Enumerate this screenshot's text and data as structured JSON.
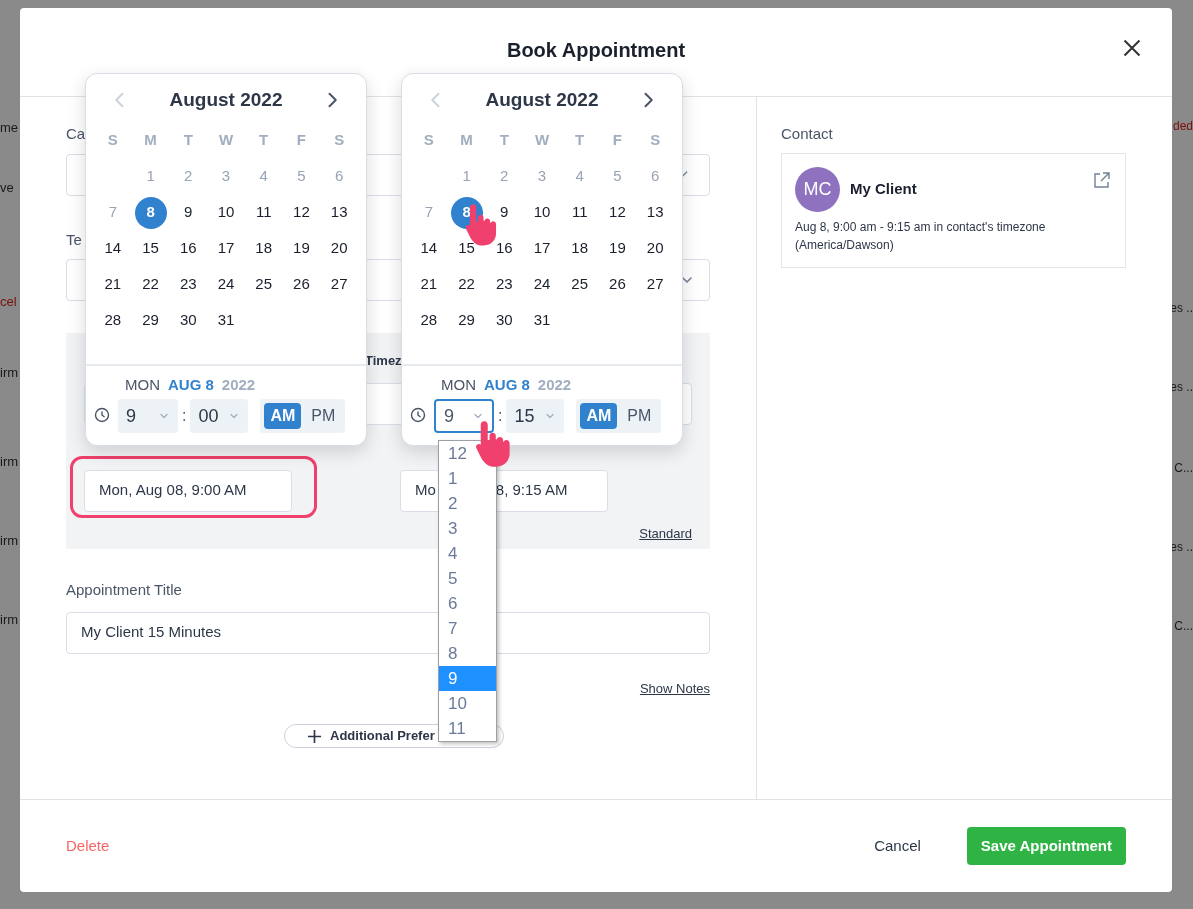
{
  "backdrop": {
    "left_fragments": [
      {
        "text": "me",
        "color": "#1a1a1a"
      },
      {
        "text": "ve",
        "color": "#1a1a1a"
      },
      {
        "text": "cel",
        "color": "#7a1010"
      },
      {
        "text": "irm",
        "color": "#1a1a1a"
      },
      {
        "text": "irm",
        "color": "#1a1a1a"
      },
      {
        "text": "irm",
        "color": "#1a1a1a"
      },
      {
        "text": "irm",
        "color": "#1a1a1a"
      }
    ],
    "right_fragments": [
      {
        "text": "ded",
        "color": "#7a1010"
      },
      {
        "text": "es ..",
        "color": "#1a1a1a"
      },
      {
        "text": "es ..",
        "color": "#1a1a1a"
      },
      {
        "text": "C...",
        "color": "#1a1a1a"
      },
      {
        "text": "es ..",
        "color": "#1a1a1a"
      },
      {
        "text": "C...",
        "color": "#1a1a1a"
      }
    ]
  },
  "modal": {
    "title": "Book Appointment"
  },
  "form": {
    "calendar_label": "Ca",
    "team_label": "Te",
    "timezone_label": "Timez",
    "start_field": {
      "value_parts": [
        "Mon, Aug 08, 9:00 AM"
      ],
      "highlighted": true
    },
    "end_field": {
      "value_parts": [
        "Mo",
        "8, 9:15 AM"
      ]
    },
    "standard_link": "Standard",
    "title_label": "Appointment Title",
    "title_value": "My Client 15 Minutes",
    "show_notes_link": "Show Notes",
    "additional_button": "Additional Prefer"
  },
  "pickers": [
    {
      "month": "August 2022",
      "weekdays": [
        "S",
        "M",
        "T",
        "W",
        "T",
        "F",
        "S"
      ],
      "days": [
        {
          "kind": "blank"
        },
        {
          "kind": "day",
          "label": "1",
          "disabled": true,
          "selected": false
        },
        {
          "kind": "day",
          "label": "2",
          "disabled": true,
          "selected": false
        },
        {
          "kind": "day",
          "label": "3",
          "disabled": true,
          "selected": false
        },
        {
          "kind": "day",
          "label": "4",
          "disabled": true,
          "selected": false
        },
        {
          "kind": "day",
          "label": "5",
          "disabled": true,
          "selected": false
        },
        {
          "kind": "day",
          "label": "6",
          "disabled": true,
          "selected": false
        },
        {
          "kind": "day",
          "label": "7",
          "disabled": true,
          "selected": false
        },
        {
          "kind": "day",
          "label": "8",
          "disabled": false,
          "selected": true
        },
        {
          "kind": "day",
          "label": "9",
          "disabled": false,
          "selected": false
        },
        {
          "kind": "day",
          "label": "10",
          "disabled": false,
          "selected": false
        },
        {
          "kind": "day",
          "label": "11",
          "disabled": false,
          "selected": false
        },
        {
          "kind": "day",
          "label": "12",
          "disabled": false,
          "selected": false
        },
        {
          "kind": "day",
          "label": "13",
          "disabled": false,
          "selected": false
        },
        {
          "kind": "day",
          "label": "14",
          "disabled": false,
          "selected": false
        },
        {
          "kind": "day",
          "label": "15",
          "disabled": false,
          "selected": false
        },
        {
          "kind": "day",
          "label": "16",
          "disabled": false,
          "selected": false
        },
        {
          "kind": "day",
          "label": "17",
          "disabled": false,
          "selected": false
        },
        {
          "kind": "day",
          "label": "18",
          "disabled": false,
          "selected": false
        },
        {
          "kind": "day",
          "label": "19",
          "disabled": false,
          "selected": false
        },
        {
          "kind": "day",
          "label": "20",
          "disabled": false,
          "selected": false
        },
        {
          "kind": "day",
          "label": "21",
          "disabled": false,
          "selected": false
        },
        {
          "kind": "day",
          "label": "22",
          "disabled": false,
          "selected": false
        },
        {
          "kind": "day",
          "label": "23",
          "disabled": false,
          "selected": false
        },
        {
          "kind": "day",
          "label": "24",
          "disabled": false,
          "selected": false
        },
        {
          "kind": "day",
          "label": "25",
          "disabled": false,
          "selected": false
        },
        {
          "kind": "day",
          "label": "26",
          "disabled": false,
          "selected": false
        },
        {
          "kind": "day",
          "label": "27",
          "disabled": false,
          "selected": false
        },
        {
          "kind": "day",
          "label": "28",
          "disabled": false,
          "selected": false
        },
        {
          "kind": "day",
          "label": "29",
          "disabled": false,
          "selected": false
        },
        {
          "kind": "day",
          "label": "30",
          "disabled": false,
          "selected": false
        },
        {
          "kind": "day",
          "label": "31",
          "disabled": false,
          "selected": false
        }
      ],
      "weekday_name": "MON",
      "date": "AUG 8",
      "year": "2022",
      "hour": "9",
      "separator": ":",
      "minute": "00",
      "hour_focused": false,
      "meridiem": [
        {
          "label": "AM",
          "selected": true
        },
        {
          "label": "PM",
          "selected": false
        }
      ]
    },
    {
      "month": "August 2022",
      "weekdays": [
        "S",
        "M",
        "T",
        "W",
        "T",
        "F",
        "S"
      ],
      "days": [
        {
          "kind": "blank"
        },
        {
          "kind": "day",
          "label": "1",
          "disabled": true,
          "selected": false
        },
        {
          "kind": "day",
          "label": "2",
          "disabled": true,
          "selected": false
        },
        {
          "kind": "day",
          "label": "3",
          "disabled": true,
          "selected": false
        },
        {
          "kind": "day",
          "label": "4",
          "disabled": true,
          "selected": false
        },
        {
          "kind": "day",
          "label": "5",
          "disabled": true,
          "selected": false
        },
        {
          "kind": "day",
          "label": "6",
          "disabled": true,
          "selected": false
        },
        {
          "kind": "day",
          "label": "7",
          "disabled": true,
          "selected": false
        },
        {
          "kind": "day",
          "label": "8",
          "disabled": false,
          "selected": true
        },
        {
          "kind": "day",
          "label": "9",
          "disabled": false,
          "selected": false
        },
        {
          "kind": "day",
          "label": "10",
          "disabled": false,
          "selected": false
        },
        {
          "kind": "day",
          "label": "11",
          "disabled": false,
          "selected": false
        },
        {
          "kind": "day",
          "label": "12",
          "disabled": false,
          "selected": false
        },
        {
          "kind": "day",
          "label": "13",
          "disabled": false,
          "selected": false
        },
        {
          "kind": "day",
          "label": "14",
          "disabled": false,
          "selected": false
        },
        {
          "kind": "day",
          "label": "15",
          "disabled": false,
          "selected": false
        },
        {
          "kind": "day",
          "label": "16",
          "disabled": false,
          "selected": false
        },
        {
          "kind": "day",
          "label": "17",
          "disabled": false,
          "selected": false
        },
        {
          "kind": "day",
          "label": "18",
          "disabled": false,
          "selected": false
        },
        {
          "kind": "day",
          "label": "19",
          "disabled": false,
          "selected": false
        },
        {
          "kind": "day",
          "label": "20",
          "disabled": false,
          "selected": false
        },
        {
          "kind": "day",
          "label": "21",
          "disabled": false,
          "selected": false
        },
        {
          "kind": "day",
          "label": "22",
          "disabled": false,
          "selected": false
        },
        {
          "kind": "day",
          "label": "23",
          "disabled": false,
          "selected": false
        },
        {
          "kind": "day",
          "label": "24",
          "disabled": false,
          "selected": false
        },
        {
          "kind": "day",
          "label": "25",
          "disabled": false,
          "selected": false
        },
        {
          "kind": "day",
          "label": "26",
          "disabled": false,
          "selected": false
        },
        {
          "kind": "day",
          "label": "27",
          "disabled": false,
          "selected": false
        },
        {
          "kind": "day",
          "label": "28",
          "disabled": false,
          "selected": false
        },
        {
          "kind": "day",
          "label": "29",
          "disabled": false,
          "selected": false
        },
        {
          "kind": "day",
          "label": "30",
          "disabled": false,
          "selected": false
        },
        {
          "kind": "day",
          "label": "31",
          "disabled": false,
          "selected": false
        }
      ],
      "weekday_name": "MON",
      "date": "AUG 8",
      "year": "2022",
      "hour": "9",
      "separator": ":",
      "minute": "15",
      "hour_focused": true,
      "meridiem": [
        {
          "label": "AM",
          "selected": true
        },
        {
          "label": "PM",
          "selected": false
        }
      ]
    }
  ],
  "hour_dropdown": [
    {
      "label": "12",
      "selected": false
    },
    {
      "label": "1",
      "selected": false
    },
    {
      "label": "2",
      "selected": false
    },
    {
      "label": "3",
      "selected": false
    },
    {
      "label": "4",
      "selected": false
    },
    {
      "label": "5",
      "selected": false
    },
    {
      "label": "6",
      "selected": false
    },
    {
      "label": "7",
      "selected": false
    },
    {
      "label": "8",
      "selected": false
    },
    {
      "label": "9",
      "selected": true
    },
    {
      "label": "10",
      "selected": false
    },
    {
      "label": "11",
      "selected": false
    }
  ],
  "contact": {
    "section_label": "Contact",
    "initials": "MC",
    "name": "My Client",
    "details": "Aug 8, 9:00 am - 9:15 am in contact's timezone (America/Dawson)"
  },
  "footer": {
    "delete": "Delete",
    "cancel": "Cancel",
    "save": "Save Appointment"
  }
}
